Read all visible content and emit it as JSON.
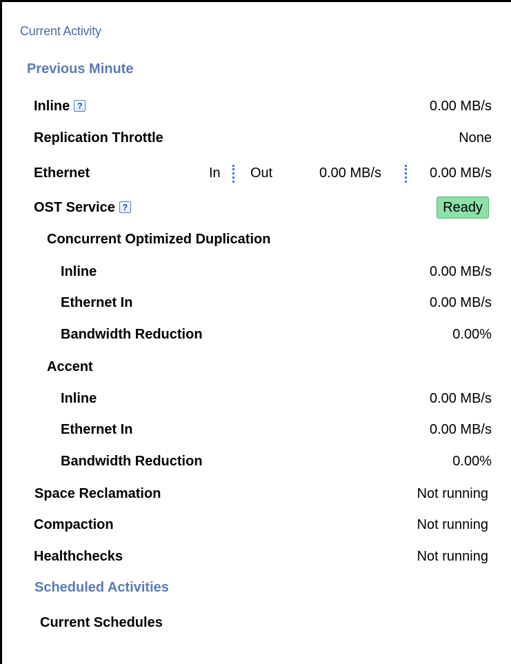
{
  "panel": {
    "title": "Current Activity"
  },
  "previous_minute": {
    "heading": "Previous Minute",
    "inline": {
      "label": "Inline",
      "value": "0.00 MB/s",
      "help": "?"
    },
    "replication_throttle": {
      "label": "Replication Throttle",
      "value": "None"
    },
    "ethernet": {
      "label": "Ethernet",
      "in_label": "In",
      "out_label": "Out",
      "in_value": "0.00 MB/s",
      "out_value": "0.00 MB/s"
    },
    "ost_service": {
      "label": "OST Service",
      "status": "Ready",
      "help": "?",
      "status_color": "#8de0aa"
    },
    "concurrent_optimized_duplication": {
      "label": "Concurrent Optimized Duplication",
      "inline": {
        "label": "Inline",
        "value": "0.00 MB/s"
      },
      "ethernet_in": {
        "label": "Ethernet In",
        "value": "0.00 MB/s"
      },
      "bandwidth_reduction": {
        "label": "Bandwidth Reduction",
        "value": "0.00%"
      }
    },
    "accent": {
      "label": "Accent",
      "inline": {
        "label": "Inline",
        "value": "0.00 MB/s"
      },
      "ethernet_in": {
        "label": "Ethernet In",
        "value": "0.00 MB/s"
      },
      "bandwidth_reduction": {
        "label": "Bandwidth Reduction",
        "value": "0.00%"
      }
    },
    "space_reclamation": {
      "label": "Space Reclamation",
      "value": "Not running"
    },
    "compaction": {
      "label": "Compaction",
      "value": "Not running"
    },
    "healthchecks": {
      "label": "Healthchecks",
      "value": "Not running"
    }
  },
  "scheduled_activities": {
    "heading": "Scheduled Activities",
    "current_schedules": {
      "label": "Current Schedules"
    }
  },
  "colors": {
    "heading": "#5b7bb8",
    "help_icon": "#1f4fb0",
    "divider_dots": "#3a7ad6"
  }
}
